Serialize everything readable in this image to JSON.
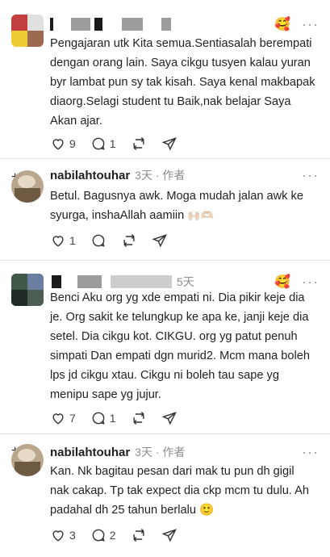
{
  "comments": [
    {
      "name": "",
      "meta": "",
      "text": "Pengajaran utk Kita semua.Sentiasalah berempati dengan orang lain. Saya cikgu tusyen kalau yuran byr lambat pun sy tak kisah. Saya kenal makbapak diaorg.Selagi student tu Baik,nak belajar Saya Akan ajar.",
      "likes": "9",
      "replies": "1",
      "reposts": ""
    },
    {
      "name": "nabilahtouhar",
      "meta": "3天 · 作者",
      "text": "Betul. Bagusnya awk. Moga mudah jalan awk ke syurga, inshaAllah aamiin",
      "emoji": "🙌🏼🫶🏼",
      "likes": "1",
      "replies": "",
      "reposts": ""
    },
    {
      "name": "",
      "meta": "5天",
      "text": "Benci Aku org yg xde empati ni. Dia pikir keje dia je. Org sakit ke telungkup ke apa ke, janji keje dia setel. Dia cikgu kot. CIKGU. org yg patut penuh simpati Dan empati dgn murid2. Mcm mana boleh lps jd cikgu xtau. Cikgu ni boleh tau sape yg menipu sape yg jujur.",
      "likes": "7",
      "replies": "1",
      "reposts": ""
    },
    {
      "name": "nabilahtouhar",
      "meta": "3天 · 作者",
      "text": "Kan. Nk bagitau pesan dari mak tu pun dh gigil nak cakap. Tp tak expect dia ckp mcm tu dulu. Ah padahal dh 25 tahun berlalu",
      "emoji": "🙂",
      "likes": "3",
      "replies": "2",
      "reposts": ""
    }
  ],
  "more_label": "···",
  "reaction_emoji": "🥰",
  "icons": [
    "heart-icon",
    "comment-icon",
    "repost-icon",
    "share-icon",
    "more-icon"
  ]
}
